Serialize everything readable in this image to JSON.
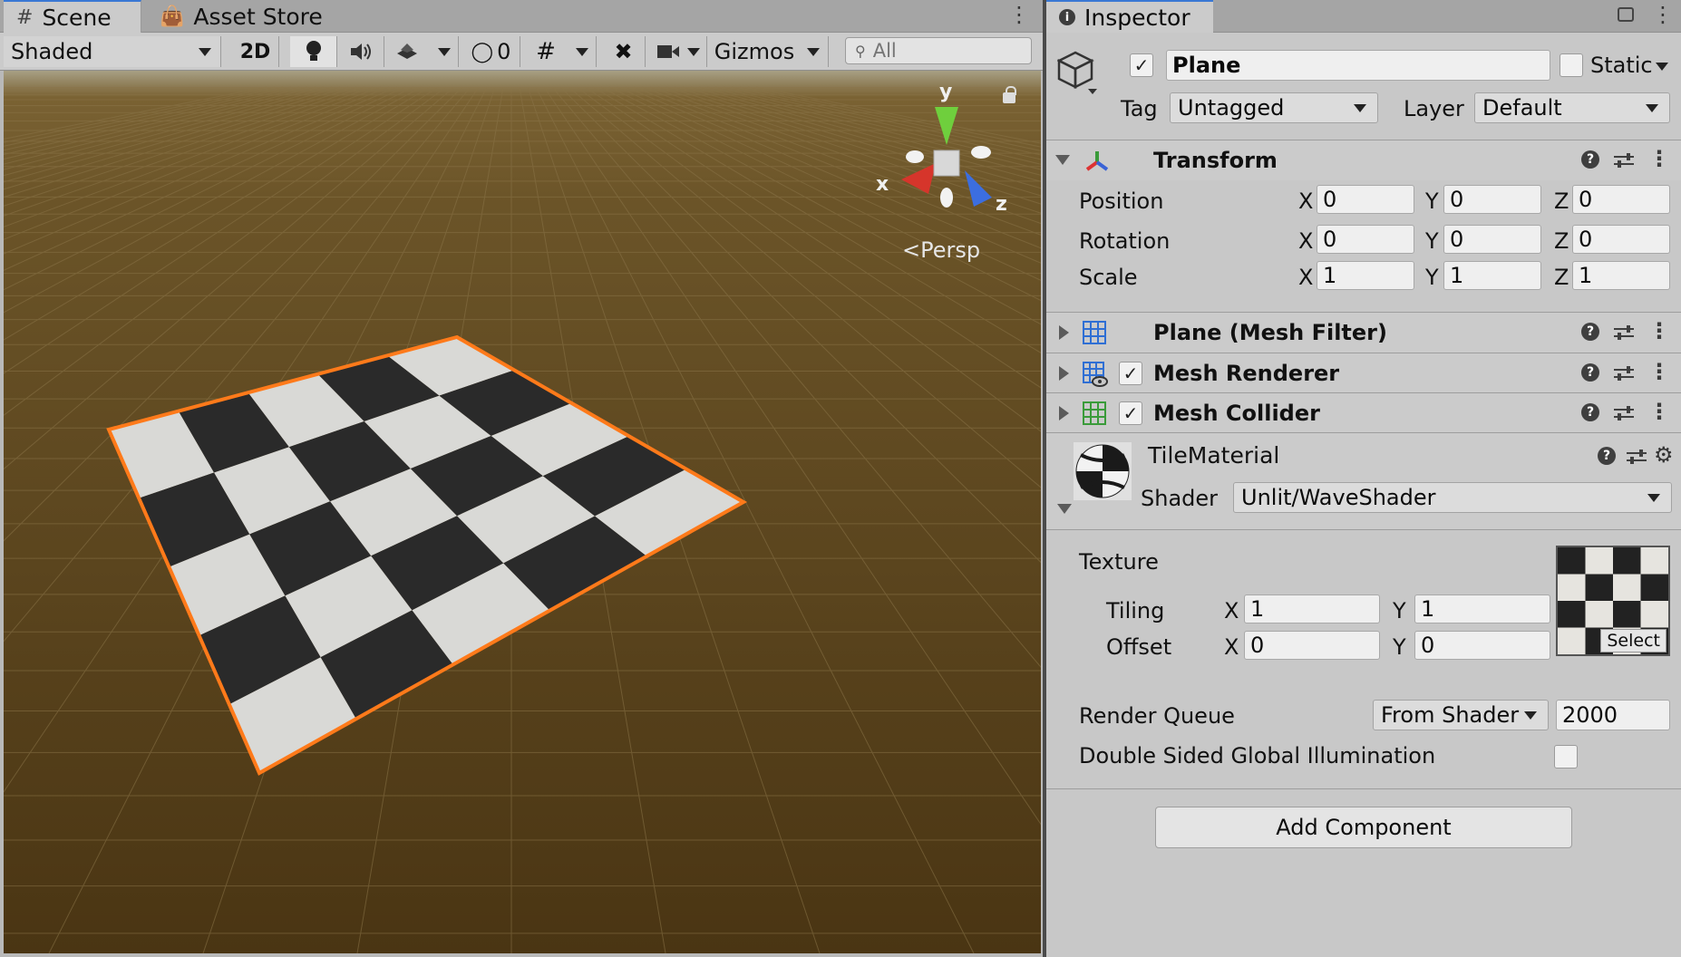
{
  "scene": {
    "tabs": [
      {
        "icon": "grid-icon",
        "label": "Scene"
      },
      {
        "icon": "bag-icon",
        "label": "Asset Store"
      }
    ],
    "toolbar": {
      "shading_mode": "Shaded",
      "btn_2d": "2D",
      "hidden_count": "0",
      "gizmos_label": "Gizmos",
      "search_placeholder": "All"
    },
    "gizmo": {
      "x": "x",
      "y": "y",
      "z": "z"
    },
    "projection_label": "Persp",
    "colors": {
      "ground_top": "#6b5428",
      "ground_bottom": "#4a3513",
      "sky": "#b0a98f",
      "selection_outline": "#ff7a1a",
      "tile_dark": "#2a2a2a",
      "tile_light": "#d9d9d6"
    }
  },
  "inspector": {
    "tab_label": "Inspector",
    "object": {
      "active": true,
      "name": "Plane",
      "static_label": "Static",
      "tag_label": "Tag",
      "tag_value": "Untagged",
      "layer_label": "Layer",
      "layer_value": "Default"
    },
    "transform": {
      "title": "Transform",
      "rows": [
        {
          "label": "Position",
          "x": "0",
          "y": "0",
          "z": "0"
        },
        {
          "label": "Rotation",
          "x": "0",
          "y": "0",
          "z": "0"
        },
        {
          "label": "Scale",
          "x": "1",
          "y": "1",
          "z": "1"
        }
      ],
      "axis_x": "X",
      "axis_y": "Y",
      "axis_z": "Z"
    },
    "components": [
      {
        "title": "Plane (Mesh Filter)",
        "icon": "mesh-filter-icon",
        "has_checkbox": false
      },
      {
        "title": "Mesh Renderer",
        "icon": "mesh-renderer-icon",
        "has_checkbox": true
      },
      {
        "title": "Mesh Collider",
        "icon": "mesh-collider-icon",
        "has_checkbox": true
      }
    ],
    "material": {
      "name": "TileMaterial",
      "shader_label": "Shader",
      "shader_value": "Unlit/WaveShader",
      "texture_label": "Texture",
      "tiling_label": "Tiling",
      "tiling_x": "1",
      "tiling_y": "1",
      "offset_label": "Offset",
      "offset_x": "0",
      "offset_y": "0",
      "axis_x": "X",
      "axis_y": "Y",
      "select_label": "Select",
      "render_queue_label": "Render Queue",
      "render_queue_mode": "From Shader",
      "render_queue_value": "2000",
      "double_sided_label": "Double Sided Global Illumination"
    },
    "add_component_label": "Add Component"
  }
}
